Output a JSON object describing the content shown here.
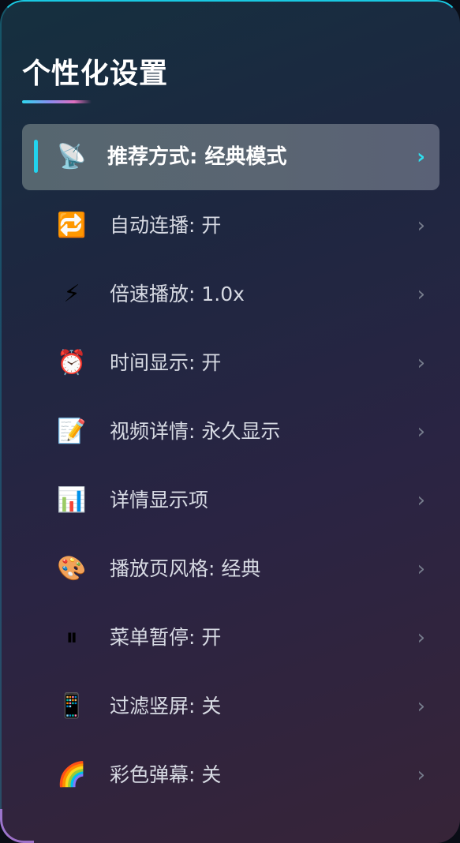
{
  "title": "个性化设置",
  "menu": [
    {
      "icon": "📡",
      "icon_name": "satellite-dish-icon",
      "label": "推荐方式: 经典模式",
      "active": true
    },
    {
      "icon": "🔁",
      "icon_name": "repeat-icon",
      "label": "自动连播: 开",
      "active": false
    },
    {
      "icon": "⚡",
      "icon_name": "lightning-icon",
      "label": "倍速播放: 1.0x",
      "active": false
    },
    {
      "icon": "⏰",
      "icon_name": "alarm-clock-icon",
      "label": "时间显示: 开",
      "active": false
    },
    {
      "icon": "📝",
      "icon_name": "memo-icon",
      "label": "视频详情: 永久显示",
      "active": false
    },
    {
      "icon": "📊",
      "icon_name": "bar-chart-icon",
      "label": "详情显示项",
      "active": false
    },
    {
      "icon": "🎨",
      "icon_name": "palette-icon",
      "label": "播放页风格: 经典",
      "active": false
    },
    {
      "icon": "⏸",
      "icon_name": "pause-icon",
      "label": "菜单暂停: 开",
      "active": false
    },
    {
      "icon": "📱",
      "icon_name": "mobile-phone-icon",
      "label": "过滤竖屏: 关",
      "active": false
    },
    {
      "icon": "🌈",
      "icon_name": "rainbow-icon",
      "label": "彩色弹幕: 关",
      "active": false
    }
  ],
  "chevron": "›",
  "colors": {
    "accent": "#22d3ee",
    "active_bg": "#56666f",
    "text": "#d7dae3"
  }
}
